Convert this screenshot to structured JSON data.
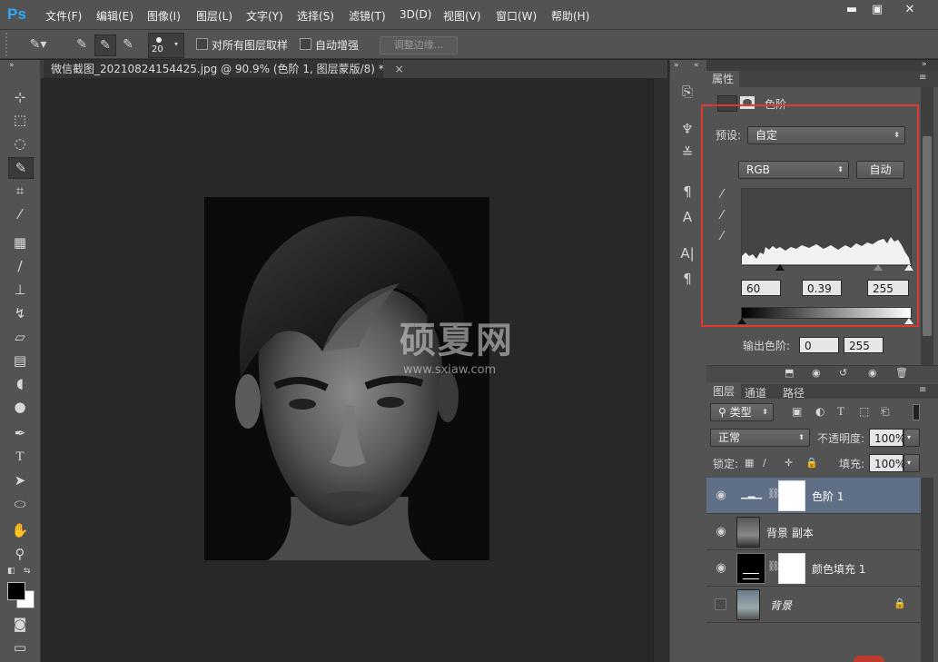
{
  "app": {
    "logo": "Ps"
  },
  "menu": [
    "文件(F)",
    "编辑(E)",
    "图像(I)",
    "图层(L)",
    "文字(Y)",
    "选择(S)",
    "滤镜(T)",
    "3D(D)",
    "视图(V)",
    "窗口(W)",
    "帮助(H)"
  ],
  "window_controls": {
    "minimize": "▬",
    "restore": "▣",
    "close": "✕"
  },
  "options": {
    "brush_size": "20",
    "sample_all_layers": "对所有图层取样",
    "auto_enhance": "自动增强",
    "refine_edge": "调整边缘..."
  },
  "document": {
    "tab_title": "微信截图_20210824154425.jpg @ 90.9% (色阶 1, 图层蒙版/8) *",
    "close": "×"
  },
  "watermark": {
    "main": "硕夏网",
    "url": "www.sxiaw.com"
  },
  "properties": {
    "tab": "属性",
    "title": "色阶",
    "preset_label": "预设:",
    "preset_value": "自定",
    "channel": "RGB",
    "auto_button": "自动",
    "input_black": "60",
    "input_gamma": "0.39",
    "input_white": "255",
    "output_label": "输出色阶:",
    "output_black": "0",
    "output_white": "255"
  },
  "layers_panel": {
    "tabs": [
      "图层",
      "通道",
      "路径"
    ],
    "filter_kind": "类型",
    "blend_mode": "正常",
    "opacity_label": "不透明度:",
    "opacity_value": "100%",
    "lock_label": "锁定:",
    "fill_label": "填充:",
    "fill_value": "100%",
    "layers": [
      {
        "name": "色阶 1",
        "visible": true,
        "selected": true
      },
      {
        "name": "背景 副本",
        "visible": true,
        "selected": false
      },
      {
        "name": "颜色填充 1",
        "visible": true,
        "selected": false
      },
      {
        "name": "背景",
        "visible": false,
        "selected": false,
        "locked": true
      }
    ]
  },
  "colors": {
    "highlight_box": "#e03a2f",
    "selected_layer": "#5f6f86",
    "ps_blue": "#31a8ff"
  }
}
